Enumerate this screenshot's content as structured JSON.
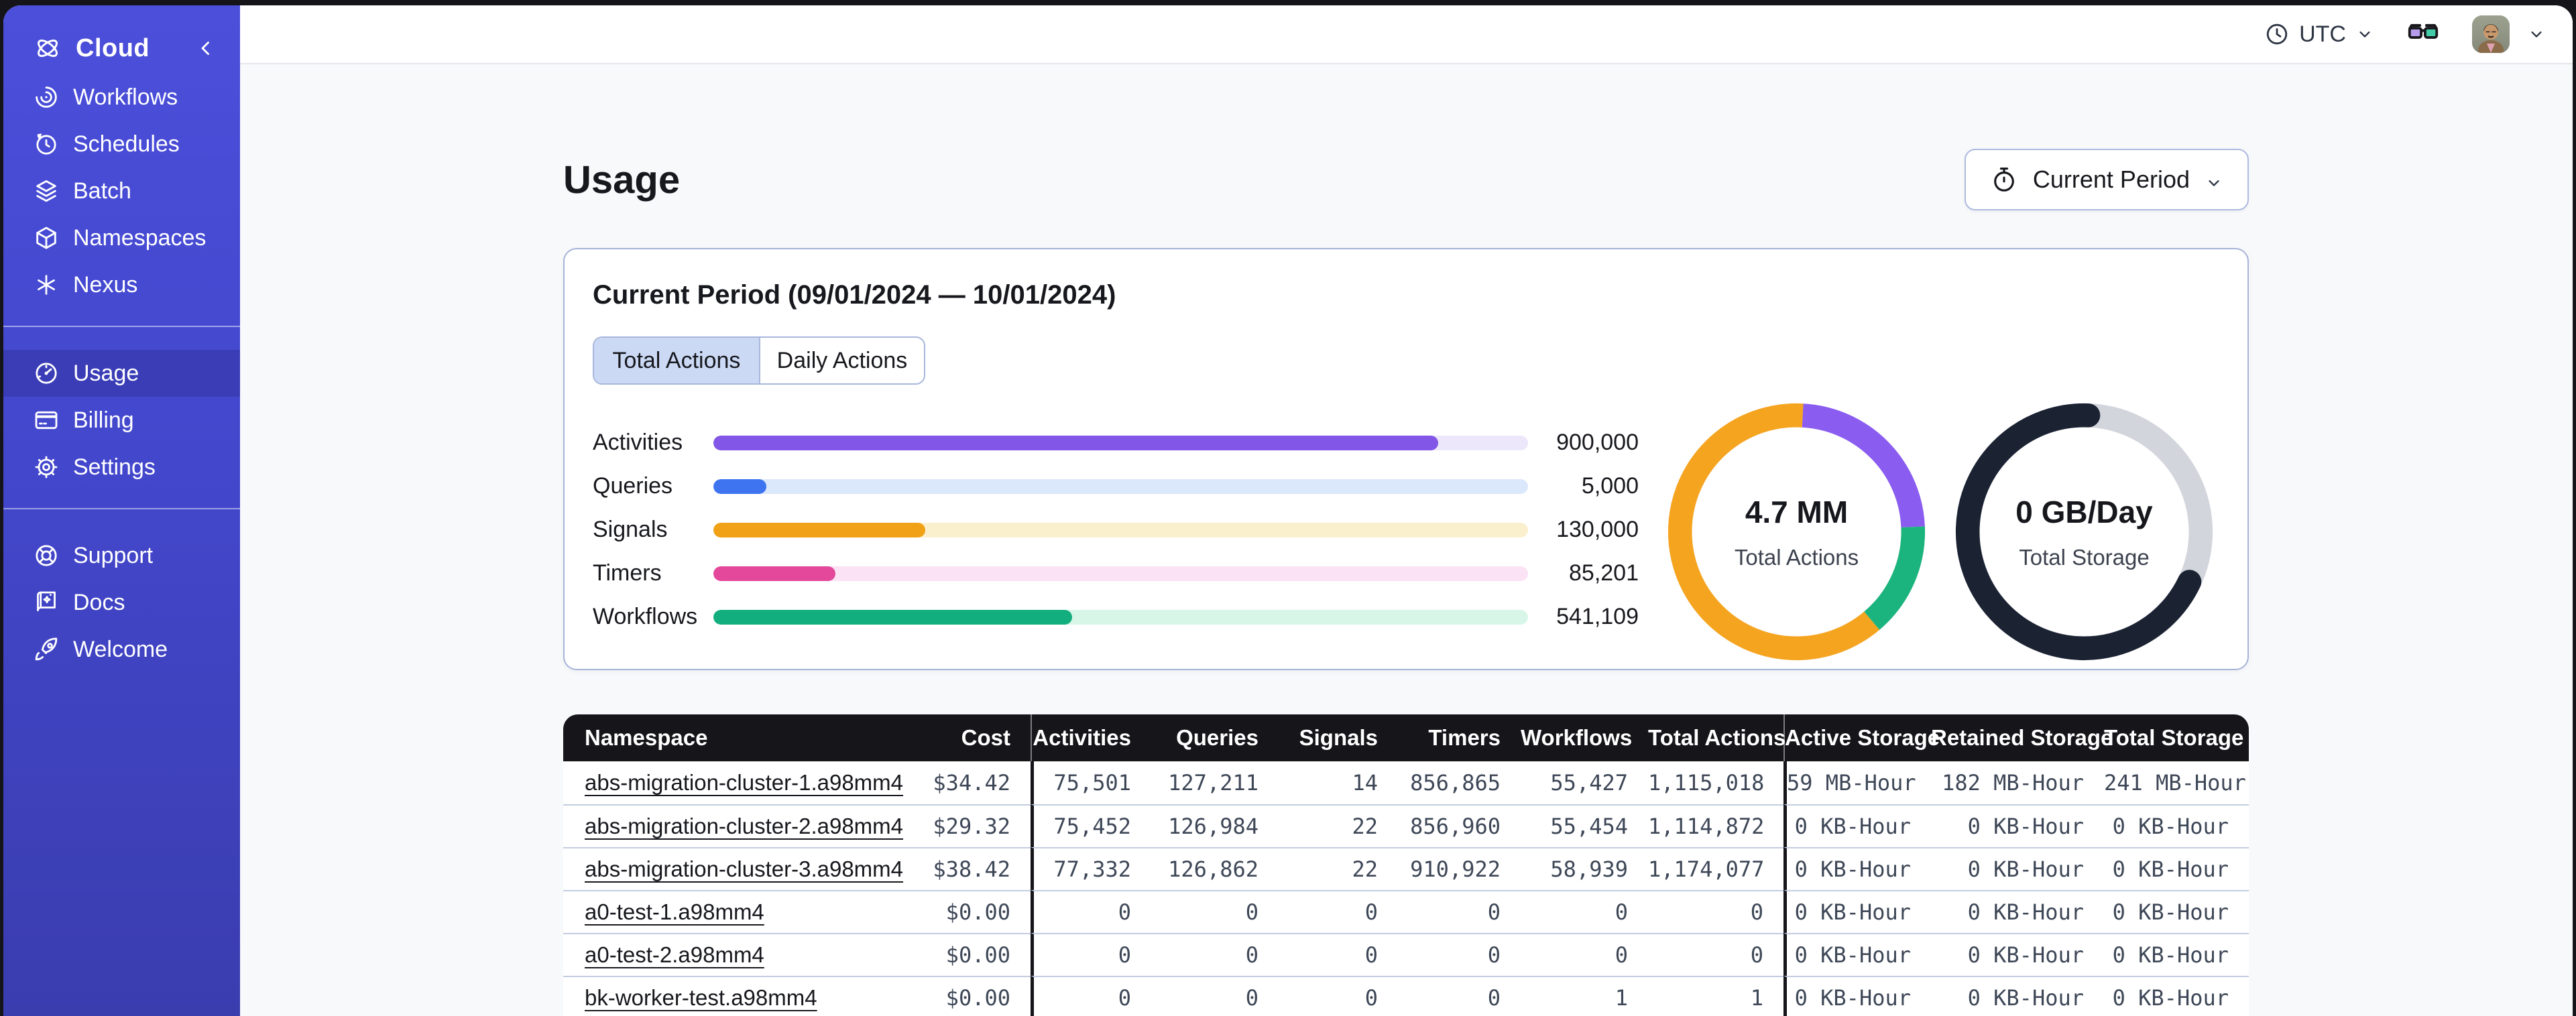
{
  "sidebar": {
    "background": "#4347CC",
    "active_background": "#3A3DB6",
    "brand": {
      "label": "Cloud"
    },
    "sections": [
      {
        "name": "primary",
        "items": [
          {
            "label": "Workflows",
            "icon": "workflows-icon"
          },
          {
            "label": "Schedules",
            "icon": "schedules-icon"
          },
          {
            "label": "Batch",
            "icon": "batch-icon"
          },
          {
            "label": "Namespaces",
            "icon": "namespaces-icon"
          },
          {
            "label": "Nexus",
            "icon": "nexus-icon"
          }
        ]
      },
      {
        "name": "account",
        "items": [
          {
            "label": "Usage",
            "icon": "usage-icon",
            "active": true
          },
          {
            "label": "Billing",
            "icon": "billing-icon"
          },
          {
            "label": "Settings",
            "icon": "settings-icon"
          }
        ]
      },
      {
        "name": "help",
        "items": [
          {
            "label": "Support",
            "icon": "support-icon"
          },
          {
            "label": "Docs",
            "icon": "docs-icon"
          },
          {
            "label": "Welcome",
            "icon": "welcome-icon"
          }
        ]
      }
    ]
  },
  "topbar": {
    "timezone": "UTC"
  },
  "page": {
    "title": "Usage",
    "period_selector": {
      "label": "Current Period",
      "icon": "stopwatch-icon"
    }
  },
  "usage_card": {
    "title": "Current Period (09/01/2024 — 10/01/2024)",
    "tabs": [
      {
        "label": "Total Actions",
        "active": true
      },
      {
        "label": "Daily Actions",
        "active": false
      }
    ]
  },
  "chart_data": [
    {
      "type": "bar",
      "orientation": "horizontal",
      "categories": [
        "Activities",
        "Queries",
        "Signals",
        "Timers",
        "Workflows"
      ],
      "values": [
        900000,
        5000,
        130000,
        85201,
        541109
      ],
      "value_labels": [
        "900,000",
        "5,000",
        "130,000",
        "85,201",
        "541,109"
      ],
      "fill_percent": [
        89,
        6.5,
        26,
        15,
        44
      ],
      "bar_colors": [
        "#8256E6",
        "#3E74F0",
        "#F0A116",
        "#E3489A",
        "#13AE7E"
      ],
      "track_colors": [
        "#EDE7FB",
        "#DBE7FA",
        "#FBF0CE",
        "#FBE2F4",
        "#D7F6E8"
      ],
      "grid": false,
      "legend": "none"
    },
    {
      "type": "pie",
      "variant": "donut",
      "label": "4.7 MM",
      "sublabel": "Total Actions",
      "start_angle_deg": 3,
      "segments": [
        {
          "name": "activities",
          "color": "#8A5CF0",
          "percent": 23.5
        },
        {
          "name": "workflows",
          "color": "#1CB47E",
          "percent": 14.5
        },
        {
          "name": "timers",
          "color": "#F5A420",
          "percent": 62
        }
      ]
    },
    {
      "type": "pie",
      "variant": "donut",
      "label": "0 GB/Day",
      "sublabel": "Total Storage",
      "start_angle_deg": 2,
      "segments": [
        {
          "name": "free",
          "color": "#D3D5DC",
          "percent": 31.5
        },
        {
          "name": "used",
          "color": "#1B2333",
          "percent": 68.5,
          "rounded": true
        }
      ]
    }
  ],
  "table": {
    "columns": [
      "Namespace",
      "Cost",
      "Activities",
      "Queries",
      "Signals",
      "Timers",
      "Workflows",
      "Total Actions",
      "Active Storage",
      "Retained Storage",
      "Total Storage"
    ],
    "rows": [
      [
        "abs-migration-cluster-1.a98mm4",
        "$34.42",
        "75,501",
        "127,211",
        "14",
        "856,865",
        "55,427",
        "1,115,018",
        "59 MB-Hour",
        "182 MB-Hour",
        "241 MB-Hour"
      ],
      [
        "abs-migration-cluster-2.a98mm4",
        "$29.32",
        "75,452",
        "126,984",
        "22",
        "856,960",
        "55,454",
        "1,114,872",
        "0 KB-Hour",
        "0 KB-Hour",
        "0 KB-Hour"
      ],
      [
        "abs-migration-cluster-3.a98mm4",
        "$38.42",
        "77,332",
        "126,862",
        "22",
        "910,922",
        "58,939",
        "1,174,077",
        "0 KB-Hour",
        "0 KB-Hour",
        "0 KB-Hour"
      ],
      [
        "a0-test-1.a98mm4",
        "$0.00",
        "0",
        "0",
        "0",
        "0",
        "0",
        "0",
        "0 KB-Hour",
        "0 KB-Hour",
        "0 KB-Hour"
      ],
      [
        "a0-test-2.a98mm4",
        "$0.00",
        "0",
        "0",
        "0",
        "0",
        "0",
        "0",
        "0 KB-Hour",
        "0 KB-Hour",
        "0 KB-Hour"
      ],
      [
        "bk-worker-test.a98mm4",
        "$0.00",
        "0",
        "0",
        "0",
        "0",
        "1",
        "1",
        "0 KB-Hour",
        "0 KB-Hour",
        "0 KB-Hour"
      ]
    ]
  }
}
